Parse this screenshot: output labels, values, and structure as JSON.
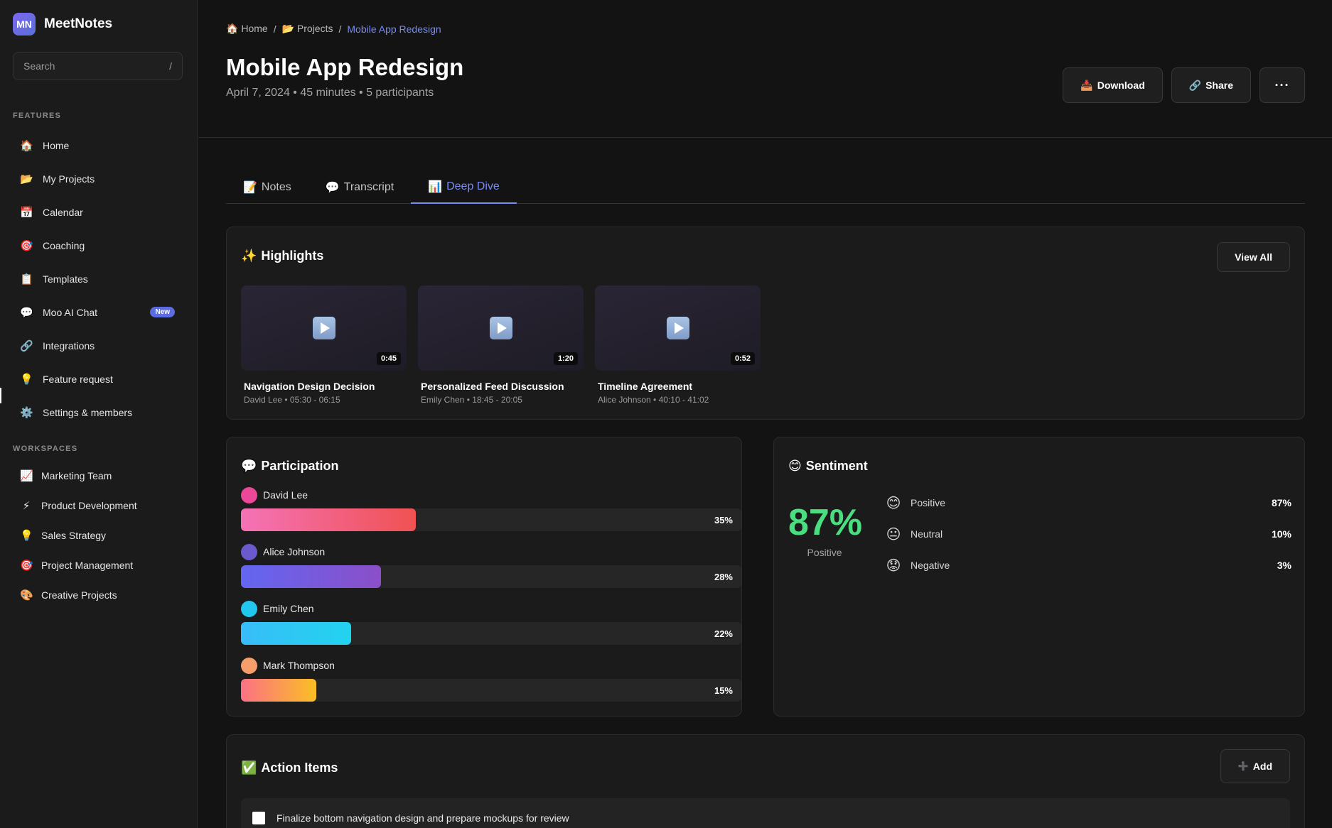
{
  "app": {
    "logo_text": "MN",
    "name": "MeetNotes"
  },
  "search": {
    "placeholder": "Search",
    "shortcut": "/"
  },
  "sidebar": {
    "features_label": "FEATURES",
    "items": [
      {
        "icon": "🏠",
        "label": "Home"
      },
      {
        "icon": "📂",
        "label": "My Projects"
      },
      {
        "icon": "📅",
        "label": "Calendar"
      },
      {
        "icon": "🎯",
        "label": "Coaching"
      },
      {
        "icon": "📋",
        "label": "Templates"
      },
      {
        "icon": "💬",
        "label": "Moo AI Chat",
        "badge": "New"
      },
      {
        "icon": "🔗",
        "label": "Integrations"
      },
      {
        "icon": "💡",
        "label": "Feature request"
      },
      {
        "icon": "⚙️",
        "label": "Settings & members"
      }
    ],
    "workspaces_label": "WORKSPACES",
    "workspaces": [
      {
        "icon": "📈",
        "label": "Marketing Team"
      },
      {
        "icon": "⚡",
        "label": "Product Development"
      },
      {
        "icon": "💡",
        "label": "Sales Strategy"
      },
      {
        "icon": "🎯",
        "label": "Project Management"
      },
      {
        "icon": "🎨",
        "label": "Creative Projects"
      }
    ]
  },
  "breadcrumb": {
    "home_icon": "🏠",
    "home": "Home",
    "projects_icon": "📂",
    "projects": "Projects",
    "separator": "/",
    "current": "Mobile App Redesign"
  },
  "page": {
    "title": "Mobile App Redesign",
    "meta": "April 7, 2024 • 45 minutes • 5 participants"
  },
  "toolbar": {
    "download_icon": "📥",
    "download": "Download",
    "share_icon": "🔗",
    "share": "Share",
    "more": "···"
  },
  "tabs": [
    {
      "icon": "📝",
      "label": "Notes"
    },
    {
      "icon": "💬",
      "label": "Transcript"
    },
    {
      "icon": "📊",
      "label": "Deep Dive"
    }
  ],
  "highlights": {
    "icon": "✨",
    "title": "Highlights",
    "view_all": "View All",
    "clips": [
      {
        "duration": "0:45",
        "title": "Navigation Design Decision",
        "meta": "David Lee • 05:30 - 06:15"
      },
      {
        "duration": "1:20",
        "title": "Personalized Feed Discussion",
        "meta": "Emily Chen • 18:45 - 20:05"
      },
      {
        "duration": "0:52",
        "title": "Timeline Agreement",
        "meta": "Alice Johnson • 40:10 - 41:02"
      }
    ]
  },
  "participation": {
    "icon": "💬",
    "title": "Participation",
    "people": [
      {
        "name": "David Lee",
        "pct_label": "35%",
        "value": 35,
        "color_from": "#f472b6",
        "color_to": "#f05252",
        "avatar": "#ec4899"
      },
      {
        "name": "Alice Johnson",
        "pct_label": "28%",
        "value": 28,
        "color_from": "#6366f1",
        "color_to": "#8b4fc8",
        "avatar": "#6a5acd"
      },
      {
        "name": "Emily Chen",
        "pct_label": "22%",
        "value": 22,
        "color_from": "#38bdf8",
        "color_to": "#22d3ee",
        "avatar": "#22c7ee"
      },
      {
        "name": "Mark Thompson",
        "pct_label": "15%",
        "value": 15,
        "color_from": "#fb7185",
        "color_to": "#fbbf24",
        "avatar": "#f59e6b"
      }
    ]
  },
  "sentiment": {
    "icon": "😊",
    "title": "Sentiment",
    "overall_pct": "87%",
    "overall_label": "Positive",
    "rows": [
      {
        "emoji": "😊",
        "label": "Positive",
        "pct": "87%"
      },
      {
        "emoji": "😐",
        "label": "Neutral",
        "pct": "10%"
      },
      {
        "emoji": "😟",
        "label": "Negative",
        "pct": "3%"
      }
    ]
  },
  "action_items": {
    "icon": "✅",
    "title": "Action Items",
    "add_icon": "➕",
    "add": "Add",
    "items": [
      {
        "text": "Finalize bottom navigation design and prepare mockups for review"
      }
    ]
  },
  "colors": {
    "accent": "#7a8cf0",
    "positive": "#4ade80",
    "badge": "#5b6be0"
  }
}
